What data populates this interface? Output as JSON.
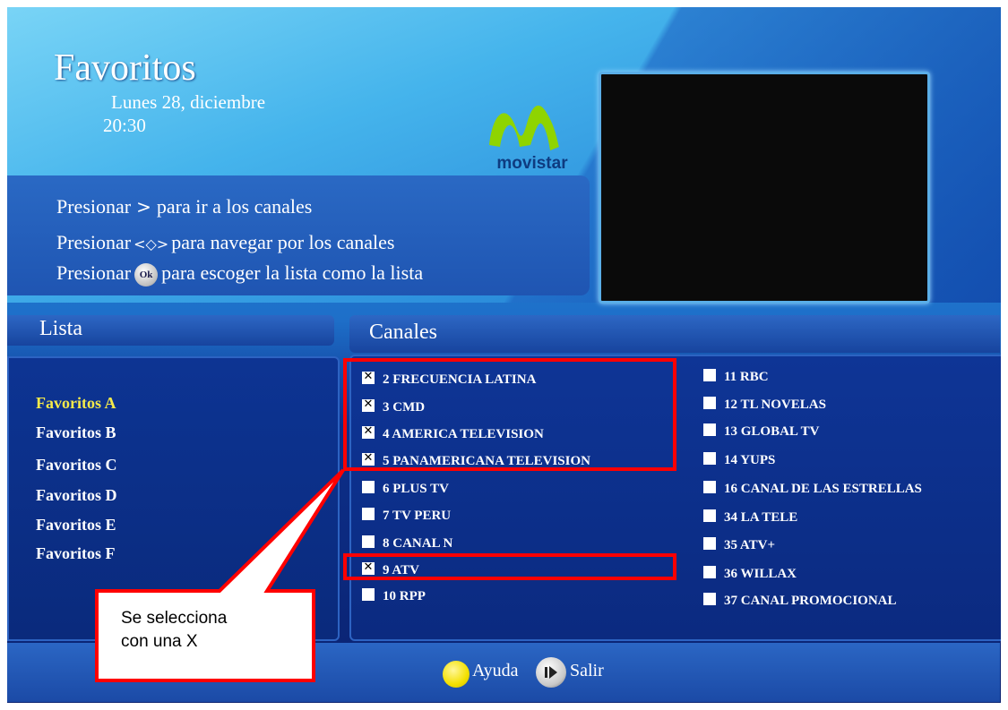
{
  "header": {
    "title": "Favoritos",
    "date": "Lunes 28, diciembre",
    "time": "20:30"
  },
  "logo": {
    "text": "movistar"
  },
  "instructions": {
    "line1_pre": "Presionar",
    "line1_post": "para ir a los canales",
    "line2_pre": "Presionar",
    "line2_post": "para navegar por los canales",
    "line3_pre": "Presionar",
    "line3_post": "para escoger la lista como la lista",
    "ok_label": "Ok"
  },
  "lista": {
    "title": "Lista",
    "items": [
      {
        "label": "Favoritos A",
        "selected": true
      },
      {
        "label": "Favoritos B",
        "selected": false
      },
      {
        "label": "Favoritos C",
        "selected": false
      },
      {
        "label": "Favoritos D",
        "selected": false
      },
      {
        "label": "Favoritos E",
        "selected": false
      },
      {
        "label": "Favoritos F",
        "selected": false
      }
    ]
  },
  "canales": {
    "title": "Canales",
    "left": [
      {
        "label": "2 FRECUENCIA LATINA",
        "checked": true
      },
      {
        "label": "3 CMD",
        "checked": true
      },
      {
        "label": "4 AMERICA TELEVISION",
        "checked": true
      },
      {
        "label": "5 PANAMERICANA TELEVISION",
        "checked": true
      },
      {
        "label": "6 PLUS TV",
        "checked": false
      },
      {
        "label": "7 TV PERU",
        "checked": false
      },
      {
        "label": "8 CANAL N",
        "checked": false
      },
      {
        "label": "9 ATV",
        "checked": true
      },
      {
        "label": "10 RPP",
        "checked": false
      }
    ],
    "right": [
      {
        "label": "11 RBC",
        "checked": false
      },
      {
        "label": "12 TL NOVELAS",
        "checked": false
      },
      {
        "label": "13 GLOBAL TV",
        "checked": false
      },
      {
        "label": "14 YUPS",
        "checked": false
      },
      {
        "label": "16 CANAL DE LAS ESTRELLAS",
        "checked": false
      },
      {
        "label": "34 LA TELE",
        "checked": false
      },
      {
        "label": "35  ATV+",
        "checked": false
      },
      {
        "label": "36 WILLAX",
        "checked": false
      },
      {
        "label": "37 CANAL PROMOCIONAL",
        "checked": false
      }
    ]
  },
  "footer": {
    "help_label": "Ayuda",
    "exit_label": "Salir"
  },
  "annotation": {
    "line1": "Se selecciona",
    "line2": "con una X"
  },
  "colors": {
    "selected_fav": "#f4e94a",
    "annotation_red": "#ff0000",
    "logo_green": "#8fd400"
  }
}
